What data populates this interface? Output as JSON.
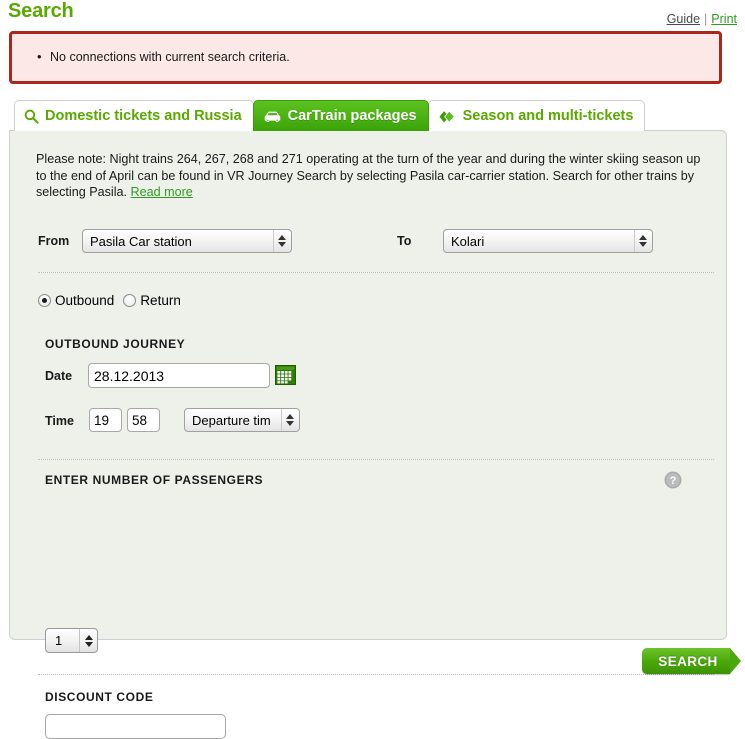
{
  "header": {
    "title": "Search",
    "links": [
      {
        "label": "Guide",
        "name": "guide-link"
      },
      {
        "label": "Print",
        "name": "print-link"
      }
    ],
    "separator": "|"
  },
  "error": {
    "messages": [
      "No connections with current search criteria."
    ],
    "border_color": "#a8291b",
    "background_color": "#fce9e7"
  },
  "tabs": [
    {
      "label": "Domestic tickets and Russia",
      "icon": "magnifier-icon",
      "active": false
    },
    {
      "label": "CarTrain packages",
      "icon": "car-icon",
      "active": true
    },
    {
      "label": "Season and multi-tickets",
      "icon": "tickets-icon",
      "active": false
    }
  ],
  "notice": {
    "text": "Please note: Night trains 264, 267, 268 and 271 operating at the turn of the year and during the winter skiing season up to the end of April can be found in VR Journey Search by selecting Pasila car-carrier station. Search for other trains by selecting Pasila. ",
    "link_label": "Read more"
  },
  "route": {
    "from_label": "From",
    "from_value": "Pasila Car station",
    "to_label": "To",
    "to_value": "Kolari"
  },
  "direction": {
    "options": [
      {
        "label": "Outbound",
        "checked": true
      },
      {
        "label": "Return",
        "checked": false
      }
    ]
  },
  "outbound": {
    "heading": "OUTBOUND JOURNEY",
    "date_label": "Date",
    "date_value": "28.12.2013",
    "time_label": "Time",
    "hour_value": "19",
    "minute_value": "58",
    "time_type_value": "Departure tim",
    "calendar_icon": "calendar-icon"
  },
  "passengers": {
    "heading": "ENTER NUMBER OF PASSENGERS",
    "count_value": "1",
    "help_icon": "help-icon"
  },
  "discount": {
    "heading": "DISCOUNT CODE",
    "value": "",
    "placeholder": ""
  },
  "actions": {
    "search_label": "SEARCH"
  },
  "colors": {
    "brand_green": "#5aa800",
    "active_tab_green": "#44b012",
    "panel_background": "#edf1ea",
    "error_red": "#a8291b"
  }
}
